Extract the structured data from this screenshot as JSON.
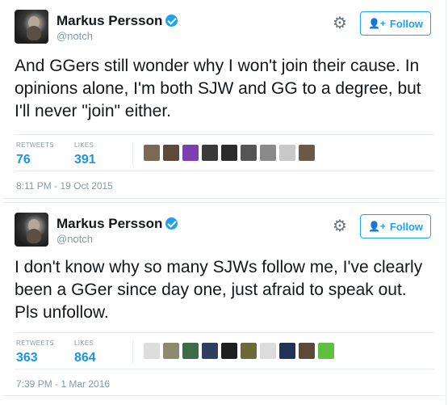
{
  "tweets": [
    {
      "author_name": "Markus Persson",
      "handle": "@notch",
      "follow_label": "Follow",
      "text": "And GGers still wonder why I won't join their cause. In opinions alone, I'm both SJW and GG to a degree, but I'll never \"join\" either.",
      "retweets_label": "RETWEETS",
      "retweets": "76",
      "likes_label": "LIKES",
      "likes": "391",
      "timestamp": "8:11 PM - 19 Oct 2015",
      "liker_avatar_colors": [
        "#7a6a55",
        "#5c4a3a",
        "#7b3fb0",
        "#3a3a3a",
        "#2b2b2b",
        "#555555",
        "#8a8a8a",
        "#c9c9c9",
        "#6a5a4a"
      ]
    },
    {
      "author_name": "Markus Persson",
      "handle": "@notch",
      "follow_label": "Follow",
      "text": "I don't know why so many SJWs follow me, I've clearly been a GGer since day one, just afraid to speak out. Pls unfollow.",
      "retweets_label": "RETWEETS",
      "retweets": "363",
      "likes_label": "LIKES",
      "likes": "864",
      "timestamp": "7:39 PM - 1 Mar 2016",
      "liker_avatar_colors": [
        "#dddddd",
        "#8c8a70",
        "#3e6b48",
        "#2f3f5f",
        "#1f1f1f",
        "#6a6a3a",
        "#dcdcdc",
        "#223355",
        "#5a4a3a",
        "#5fbf3f"
      ]
    }
  ],
  "icons": {
    "verified": "verified-badge-icon",
    "gear": "gear-icon",
    "follow": "add-user-icon"
  },
  "colors": {
    "accent": "#1da1f2",
    "stat_value": "#1b95e0",
    "muted": "#8899a6"
  }
}
